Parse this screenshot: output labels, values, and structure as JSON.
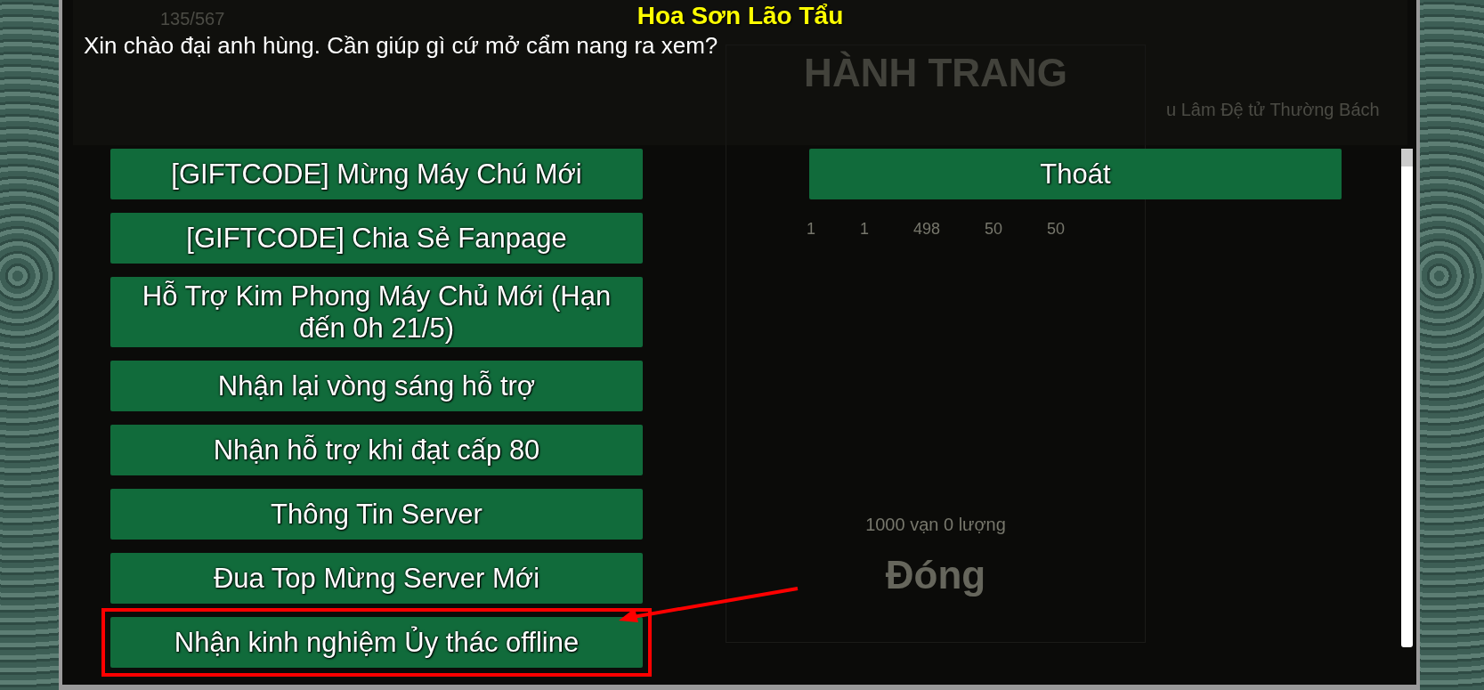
{
  "npc_name": "Hoa Sơn Lão Tẩu",
  "greeting": "Xin chào đại anh hùng. Cần giúp gì cứ mở cẩm nang ra xem?",
  "options": [
    {
      "label": "[GIFTCODE] Mừng Máy Chú Mới",
      "highlighted": false
    },
    {
      "label": "[GIFTCODE] Chia Sẻ Fanpage",
      "highlighted": false
    },
    {
      "label": "Hỗ Trợ Kim Phong Máy Chủ Mới (Hạn đến 0h 21/5)",
      "highlighted": false
    },
    {
      "label": "Nhận lại vòng sáng hỗ trợ",
      "highlighted": false
    },
    {
      "label": "Nhận hỗ trợ khi đạt cấp 80",
      "highlighted": false
    },
    {
      "label": "Thông Tin Server",
      "highlighted": false
    },
    {
      "label": "Đua Top Mừng Server Mới",
      "highlighted": false
    },
    {
      "label": "Nhận kinh nghiệm Ủy thác offline",
      "highlighted": true
    }
  ],
  "exit_button": "Thoát",
  "background": {
    "hp": "135/567",
    "inventory_title": "HÀNH TRANG",
    "item_counts": [
      "1",
      "1",
      "498",
      "50",
      "50"
    ],
    "money": "1000 vạn 0 lượng",
    "close_label": "Đóng",
    "quest_text": "u Lâm Đệ tử Thường Bách"
  }
}
